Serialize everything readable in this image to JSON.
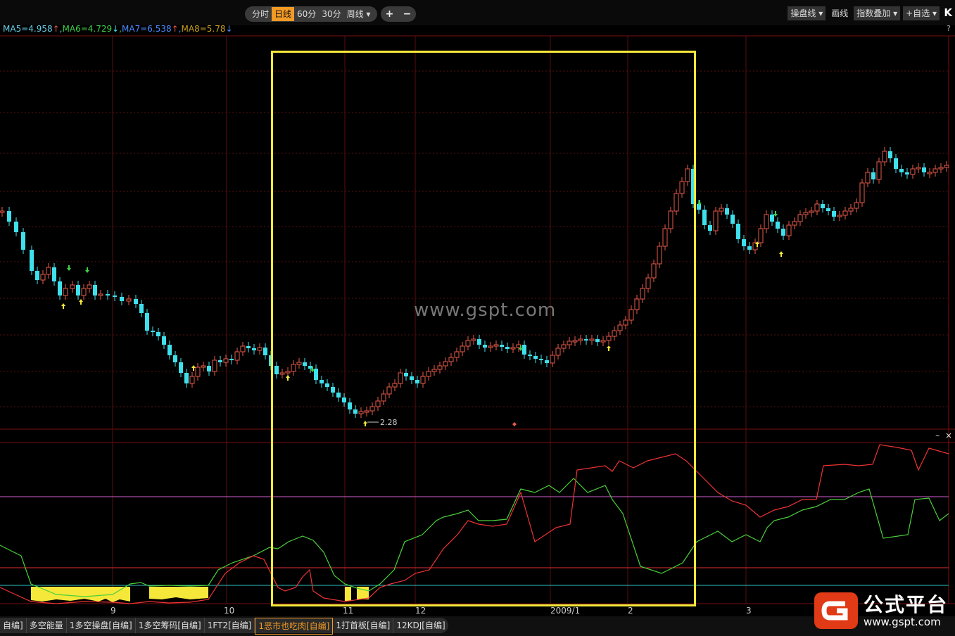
{
  "toolbar": {
    "timeframes": [
      "分时",
      "日线",
      "60分",
      "30分",
      "周线 ▾"
    ],
    "active_timeframe": "日线",
    "zoom_in": "+",
    "zoom_out": "−",
    "right_buttons": [
      "操盘线 ▾",
      "画线",
      "指数叠加 ▾",
      "+自选 ▾"
    ],
    "k_label": "K"
  },
  "ma": {
    "ma5": {
      "label": "MA5=4.958",
      "arrow": "↑",
      "color": "#6ad0e8"
    },
    "ma6": {
      "label": "MA6=4.729",
      "arrow": "↓",
      "color": "#3fd24a"
    },
    "ma7": {
      "label": "MA7=6.538",
      "arrow": "↑",
      "color": "#4a8cff"
    },
    "ma8": {
      "label": "MA8=5.78",
      "arrow": "↓",
      "color": "#c9a020"
    },
    "help": "?"
  },
  "annotations": {
    "low_label": "2.28"
  },
  "x_axis": {
    "labels": [
      "9",
      "10",
      "11",
      "12",
      "2009/1",
      "2",
      "3"
    ]
  },
  "indicator": {
    "close": "×",
    "min": "–"
  },
  "watermark": "www.gspt.com",
  "tabs": [
    "自编]",
    "多空能量",
    "1多空操盘[自编]",
    "1多空筹码[自编]",
    "1FT2[自编]",
    "1恶市也吃肉[自编]",
    "1打首板[自编]",
    "12KDJ[自编]"
  ],
  "active_tab": "1恶市也吃肉[自编]",
  "logo": {
    "title": "公式平台",
    "url": "www.gspt.com"
  },
  "colors": {
    "up": "#e85b4a",
    "down": "#3ee0ec",
    "highlight": "#f5e83a",
    "indicator_red": "#e33",
    "indicator_green": "#4ad03a"
  }
}
